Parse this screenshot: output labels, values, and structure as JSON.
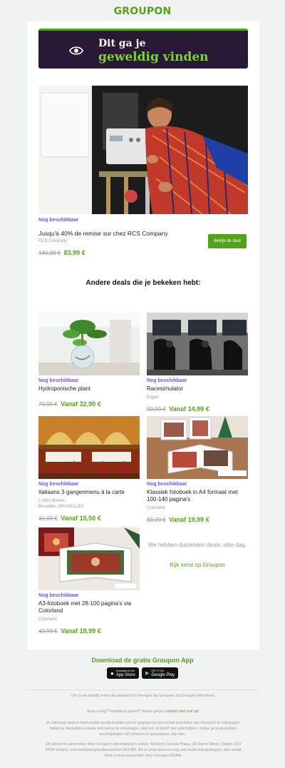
{
  "brand": {
    "logo_text": "GROUPON",
    "accent": "#53a318",
    "purple": "#6a5cd9"
  },
  "banner": {
    "line1": "Dit ga je",
    "line2": "geweldig vinden",
    "icon": "eye-icon"
  },
  "hero": {
    "availability": "Nog beschikbaar",
    "title": "Jusqu'à 40% de remise sur chez RCS Company",
    "merchant": "RCS Company",
    "old_price": "140,00 €",
    "new_price": "83,99 €",
    "cta": "Bekijk de deal"
  },
  "section_title": "Andere deals die je bekeken hebt:",
  "deals": [
    {
      "availability": "Nog beschikbaar",
      "title": "Hydroponische plant",
      "merchant": "",
      "location": "",
      "old_price": "79,95 €",
      "new_price": "Vanaf 32,90 €"
    },
    {
      "availability": "Nog beschikbaar",
      "title": "Racesimulator",
      "merchant": "Exype",
      "location": "",
      "old_price": "30,00 €",
      "new_price": "Vanaf 14,99 €"
    },
    {
      "availability": "Nog beschikbaar",
      "title": "Italiaans 3-gangenmenu à la carte",
      "merchant": "L Altro Mondo",
      "location": "Bruxelles, BRUXELLES",
      "old_price": "41,00 €",
      "new_price": "Vanaf 15,50 €"
    },
    {
      "availability": "Nog beschikbaar",
      "title": "Klassiek fotoboek in A4 formaat met 100-140 pagina's",
      "merchant": "Colorland",
      "location": "",
      "old_price": "83,99 €",
      "new_price": "Vanaf 19,99 €"
    },
    {
      "availability": "Nog beschikbaar",
      "title": "A3-fotoboek met 28-100 pagina's via Colorland",
      "merchant": "Colorland",
      "location": "",
      "old_price": "49,99 €",
      "new_price": "Vanaf 18,99 €"
    }
  ],
  "promo": {
    "text": "We hebben duizenden deals, elke dag.",
    "link": "Kijk eerst op Groupon"
  },
  "app": {
    "title": "Download de gratis Groupon App",
    "appstore_small": "Download on the",
    "appstore": "App Store",
    "googleplay_small": "GET IT ON",
    "googleplay": "Google Play"
  },
  "footer": {
    "merchant_text": "Om jouw bedrijf onder de aandacht te brengen op Groupon, bij Groupon Merchant.",
    "help_text": "Hulp nodig? Feedback geven? Neem gerust",
    "help_link": "contact met ons op!",
    "email_text": "Je ontvangt deze e-mail omdat xxx@ureader.com is opgegeven om e-mail berichten van Groupon te ontvangen. Indien je dergelijke e-mails niet wenst te ontvangen, dan kun je jezelf met uitschrijven. Indien je jouw andere inschrijvingen wil beheren of aanpassen, klik dan .",
    "legal_text": "Dit bericht is verzonden door Groupon International Limited, WeWork Central Plaza, 36 Dame Street, Dublin D02 EF64 Ierland, met bedrijfsregistratienummer 501358. Als je jouw account nog niet heeft overgedragen, dan wordt deze e-mail verzonden door Groupon BVBA."
  }
}
